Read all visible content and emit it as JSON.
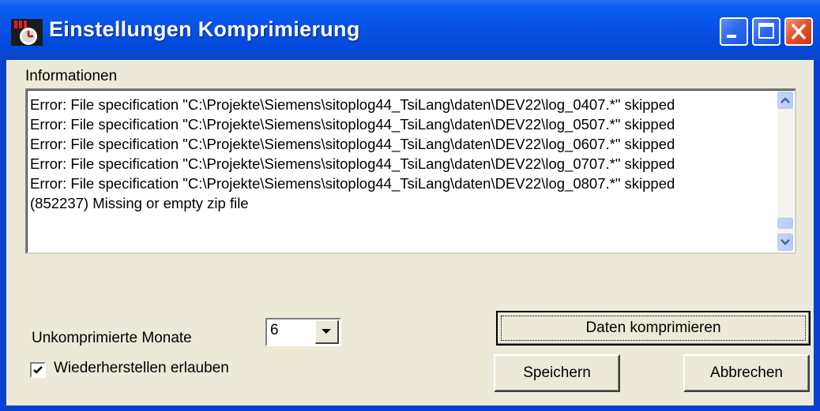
{
  "window": {
    "title": "Einstellungen Komprimierung"
  },
  "info": {
    "label": "Informationen",
    "lines": [
      "Error: File specification \"C:\\Projekte\\Siemens\\sitoplog44_TsiLang\\daten\\DEV22\\log_0407.*\" skipped",
      "Error: File specification \"C:\\Projekte\\Siemens\\sitoplog44_TsiLang\\daten\\DEV22\\log_0507.*\" skipped",
      "Error: File specification \"C:\\Projekte\\Siemens\\sitoplog44_TsiLang\\daten\\DEV22\\log_0607.*\" skipped",
      "Error: File specification \"C:\\Projekte\\Siemens\\sitoplog44_TsiLang\\daten\\DEV22\\log_0707.*\" skipped",
      "Error: File specification \"C:\\Projekte\\Siemens\\sitoplog44_TsiLang\\daten\\DEV22\\log_0807.*\" skipped",
      "(852237) Missing or empty zip file"
    ]
  },
  "settings": {
    "months_label": "Unkomprimierte Monate",
    "months_value": "6",
    "restore_label": "Wiederherstellen erlauben",
    "restore_checked": true
  },
  "buttons": {
    "compress": "Daten komprimieren",
    "save": "Speichern",
    "cancel": "Abbrechen"
  },
  "colors": {
    "titlebar": "#0653e6",
    "dialog_bg": "#ece9d8",
    "close_button": "#e2512b"
  }
}
